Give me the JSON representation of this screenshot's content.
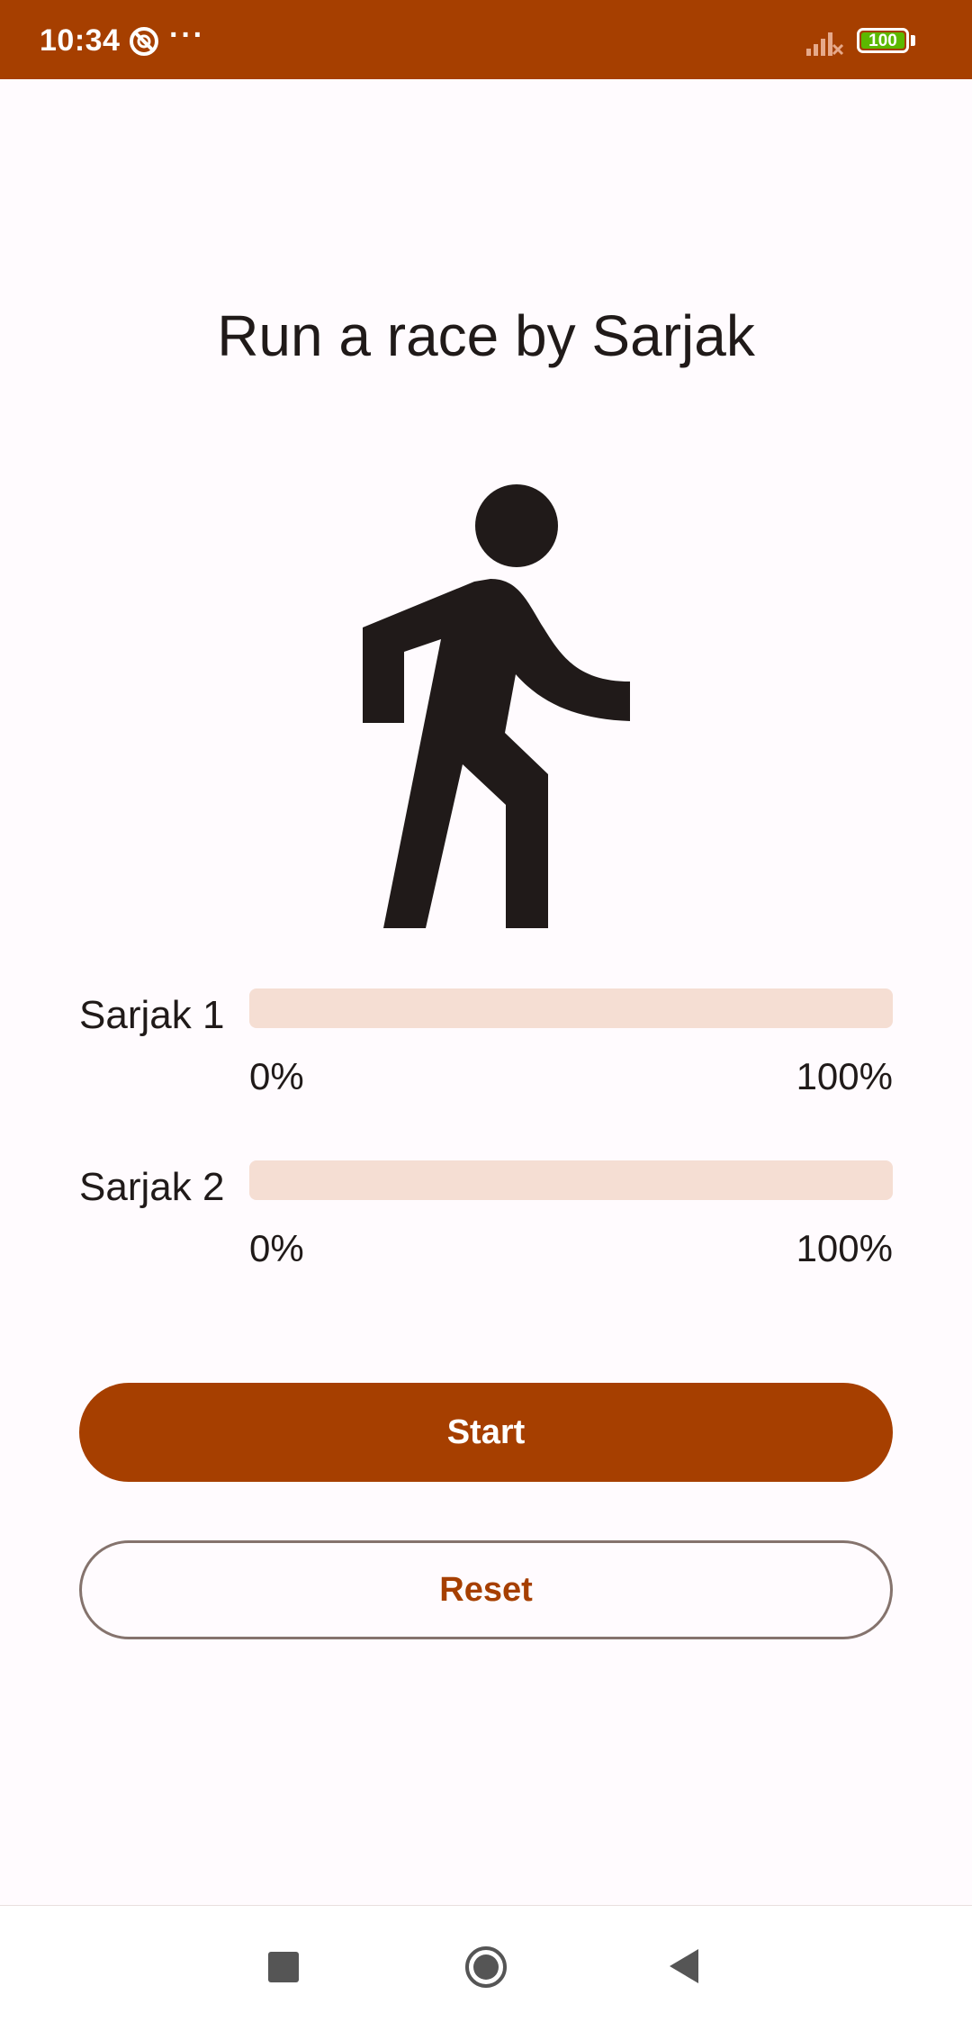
{
  "status_bar": {
    "time": "10:34",
    "dots": "···",
    "battery": "100",
    "icons": [
      "dnd-icon",
      "signal-icon",
      "battery-icon"
    ],
    "background_color": "#A63F00"
  },
  "title": "Run a race by Sarjak",
  "figure_icon": "walking-person-icon",
  "racers": [
    {
      "label": "Sarjak 1",
      "progress": 0,
      "min_label": "0%",
      "max_label": "100%"
    },
    {
      "label": "Sarjak 2",
      "progress": 0,
      "min_label": "0%",
      "max_label": "100%"
    }
  ],
  "buttons": {
    "start": "Start",
    "reset": "Reset"
  },
  "nav_bar": {
    "icons": [
      "recents-square-icon",
      "home-circle-icon",
      "back-triangle-icon"
    ]
  },
  "colors": {
    "accent": "#A63F00",
    "track": "#F5DED3",
    "text": "#201A19",
    "outline": "#85736D"
  }
}
